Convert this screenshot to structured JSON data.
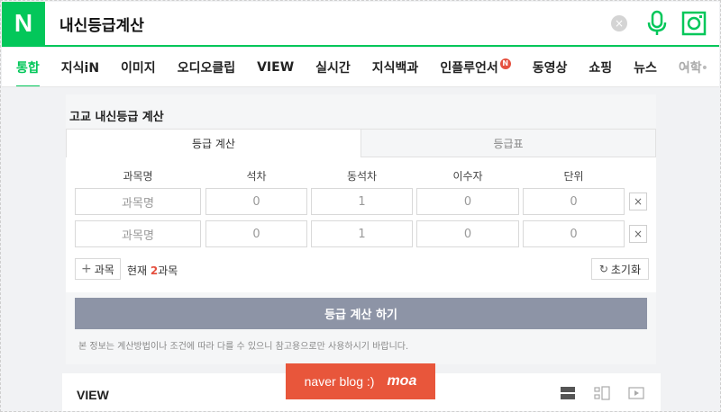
{
  "search": {
    "logo": "N",
    "query": "내신등급계산",
    "clear_icon": "×"
  },
  "tabs": [
    {
      "label": "통합",
      "active": true
    },
    {
      "label": "지식iN"
    },
    {
      "label": "이미지"
    },
    {
      "label": "오디오클립"
    },
    {
      "label": "VIEW"
    },
    {
      "label": "실시간"
    },
    {
      "label": "지식백과"
    },
    {
      "label": "인플루언서",
      "badge": "N"
    },
    {
      "label": "동영상"
    },
    {
      "label": "쇼핑"
    },
    {
      "label": "뉴스"
    },
    {
      "label": "어학"
    }
  ],
  "more_label": "•••",
  "calculator": {
    "title": "고교 내신등급 계산",
    "tab_calc": "등급 계산",
    "tab_table": "등급표",
    "headers": [
      "과목명",
      "석차",
      "동석차",
      "이수자",
      "단위"
    ],
    "rows": [
      {
        "subject": "과목명",
        "rank": "0",
        "tie": "1",
        "students": "0",
        "unit": "0"
      },
      {
        "subject": "과목명",
        "rank": "0",
        "tie": "1",
        "students": "0",
        "unit": "0"
      }
    ],
    "delete_label": "×",
    "add_label": "과목",
    "count_prefix": "현재 ",
    "count_num": "2",
    "count_suffix": "과목",
    "reset_label": "초기화",
    "submit_label": "등급 계산 하기",
    "notice": "본 정보는 계산방법이나 조건에 따라 다를 수 있으니 참고용으로만 사용하시기 바랍니다."
  },
  "view_section": {
    "title": "VIEW"
  },
  "watermark": {
    "text_a": "naver blog :)",
    "text_b": "moa"
  },
  "colors": {
    "brand": "#03c75a",
    "accent_red": "#e5503f",
    "button_gray": "#8d94a6"
  }
}
